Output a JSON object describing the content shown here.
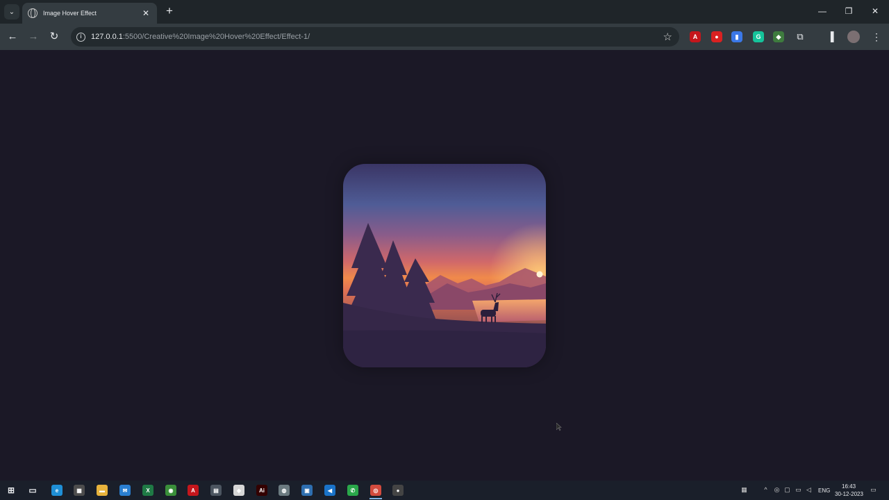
{
  "browser": {
    "tab_title": "Image Hover Effect",
    "tab_close": "✕",
    "new_tab": "+",
    "tab_menu": "⌄",
    "window_controls": {
      "minimize": "—",
      "restore": "❐",
      "close": "✕"
    },
    "nav": {
      "back": "←",
      "forward": "→",
      "reload": "↻"
    },
    "url_host": "127.0.0.1",
    "url_path": ":5500/Creative%20Image%20Hover%20Effect/Effect-1/",
    "bookmark_star": "☆"
  },
  "extensions": [
    {
      "name": "pdf-extension",
      "label": "A",
      "color": "#c4161c"
    },
    {
      "name": "adblock-extension",
      "label": "●",
      "color": "#d92121"
    },
    {
      "name": "docs-extension",
      "label": "▮",
      "color": "#3b78e7"
    },
    {
      "name": "grammarly-extension",
      "label": "G",
      "color": "#15c39a"
    },
    {
      "name": "color-picker-extension",
      "label": "◆",
      "color": "#3e7b3e"
    }
  ],
  "taskbar": {
    "apps": [
      {
        "name": "start-icon",
        "label": "⊞",
        "color": "transparent"
      },
      {
        "name": "task-view-icon",
        "label": "▭",
        "color": "transparent"
      },
      {
        "name": "edge-icon",
        "label": "e",
        "color": "#1f8fd6"
      },
      {
        "name": "store-icon",
        "label": "▦",
        "color": "#4d4d4d"
      },
      {
        "name": "file-explorer-icon",
        "label": "▬",
        "color": "#e8b33c"
      },
      {
        "name": "mail-icon",
        "label": "✉",
        "color": "#2a7fd1"
      },
      {
        "name": "excel-icon",
        "label": "X",
        "color": "#1f7a45"
      },
      {
        "name": "chrome-icon",
        "label": "◉",
        "color": "#3a8f3a"
      },
      {
        "name": "acrobat-icon",
        "label": "A",
        "color": "#c4161c"
      },
      {
        "name": "calculator-icon",
        "label": "▤",
        "color": "#4c5560"
      },
      {
        "name": "unity-icon",
        "label": "◈",
        "color": "#d6d6d6"
      },
      {
        "name": "illustrator-icon",
        "label": "Ai",
        "color": "#330000"
      },
      {
        "name": "photos-icon",
        "label": "◍",
        "color": "#6b7a80"
      },
      {
        "name": "remote-icon",
        "label": "▣",
        "color": "#2e6fb0"
      },
      {
        "name": "vscode-icon",
        "label": "◀",
        "color": "#1a73c8"
      },
      {
        "name": "whatsapp-icon",
        "label": "✆",
        "color": "#2aa84a"
      },
      {
        "name": "chrome-canary-icon",
        "label": "◎",
        "color": "#d24b3e"
      },
      {
        "name": "recorder-icon",
        "label": "●",
        "color": "#444444"
      }
    ],
    "tray": {
      "language": "ENG",
      "time": "16:43",
      "date": "30-12-2023",
      "chevron": "^",
      "notification": "▭"
    }
  },
  "colors": {
    "page_background": "#1b1826",
    "sky_top": "#4a4f8c",
    "sky_mid": "#c06a6e",
    "horizon": "#f08a4b",
    "sun": "#fff4d6"
  }
}
